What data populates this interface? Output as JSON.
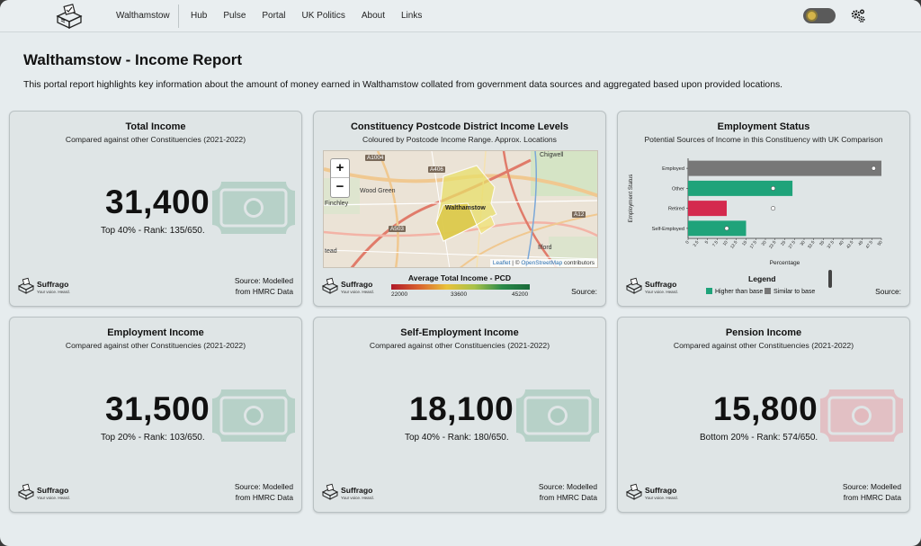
{
  "nav": {
    "title": "Walthamstow",
    "links": [
      "Hub",
      "Pulse",
      "Portal",
      "UK Politics",
      "About",
      "Links"
    ],
    "icons": {
      "logo": "ballot-box-logo",
      "theme_toggle": "sun-toggle",
      "settings": "gears-icon"
    }
  },
  "header": {
    "title": "Walthamstow - Income Report",
    "description": "This portal report highlights key information about the amount of money earned in Walthamstow collated from government data sources and aggregated based upon provided locations."
  },
  "brand": {
    "name": "Suffrago",
    "tagline": "Your voice. Heard."
  },
  "cards": {
    "total": {
      "title": "Total Income",
      "subtitle": "Compared against other Constituencies (2021-2022)",
      "value": "31,400",
      "rank": "Top 40% - Rank: 135/650.",
      "source_line1": "Source: Modelled",
      "source_line2": "from HMRC Data",
      "bill_color": "#a9c9bd"
    },
    "map": {
      "title": "Constituency Postcode District Income Levels",
      "subtitle": "Coloured by Postcode Income Range. Approx. Locations",
      "zoom_in": "+",
      "zoom_out": "−",
      "labels": {
        "chigwell": "Chigwell",
        "wood_green": "Wood Green",
        "finchley": "Finchley",
        "walthamstow": "Walthamstow",
        "ilford": "Ilford",
        "tead": "tead"
      },
      "roads": {
        "a1004": "A1004",
        "a406": "A406",
        "a12": "A12",
        "a503": "A503"
      },
      "attribution_leaflet": "Leaflet",
      "attribution_sep": " | © ",
      "attribution_osm": "OpenStreetMap",
      "attribution_tail": " contributors",
      "legend_title": "Average Total Income - PCD",
      "legend_min": "22000",
      "legend_mid": "33600",
      "legend_max": "45200",
      "source": "Source:"
    },
    "employment_status": {
      "title": "Employment Status",
      "subtitle": "Potential Sources of Income in this Constituency with UK Comparison",
      "ylabel": "Employment Status",
      "xlabel": "Percentage",
      "legend_title": "Legend",
      "legend_higher": "Higher than base",
      "legend_similar": "Similar to base",
      "source": "Source:",
      "colors": {
        "higher": "#1fa37a",
        "similar": "#777777",
        "lower": "#d42a4e"
      }
    },
    "employment": {
      "title": "Employment Income",
      "subtitle": "Compared against other Constituencies (2021-2022)",
      "value": "31,500",
      "rank": "Top 20% - Rank: 103/650.",
      "source_line1": "Source: Modelled",
      "source_line2": "from HMRC Data",
      "bill_color": "#a9c9bd"
    },
    "self_employment": {
      "title": "Self-Employment Income",
      "subtitle": "Compared against other Constituencies (2021-2022)",
      "value": "18,100",
      "rank": "Top 40% - Rank: 180/650.",
      "source_line1": "Source: Modelled",
      "source_line2": "from HMRC Data",
      "bill_color": "#a9c9bd"
    },
    "pension": {
      "title": "Pension Income",
      "subtitle": "Compared against other Constituencies (2021-2022)",
      "value": "15,800",
      "rank": "Bottom 20% - Rank: 574/650.",
      "source_line1": "Source: Modelled",
      "source_line2": "from HMRC Data",
      "bill_color": "#e2b7bc"
    }
  },
  "chart_data": {
    "type": "bar",
    "orientation": "horizontal",
    "categories": [
      "Employed",
      "Other",
      "Retired",
      "Self-Employed"
    ],
    "series": [
      {
        "values": [
          50,
          27,
          10,
          15
        ]
      }
    ],
    "bar_status": [
      "similar",
      "higher",
      "lower",
      "higher"
    ],
    "uk_base": [
      48,
      22,
      22,
      10
    ],
    "xlabel": "Percentage",
    "ylabel": "Employment Status",
    "xlim": [
      0,
      50
    ],
    "xticks": [
      "0",
      "2.5",
      "5",
      "7.5",
      "10",
      "12.5",
      "15",
      "17.5",
      "20",
      "22.5",
      "25",
      "27.5",
      "30",
      "32.5",
      "35",
      "37.5",
      "40",
      "42.5",
      "45",
      "47.5",
      "50"
    ]
  }
}
